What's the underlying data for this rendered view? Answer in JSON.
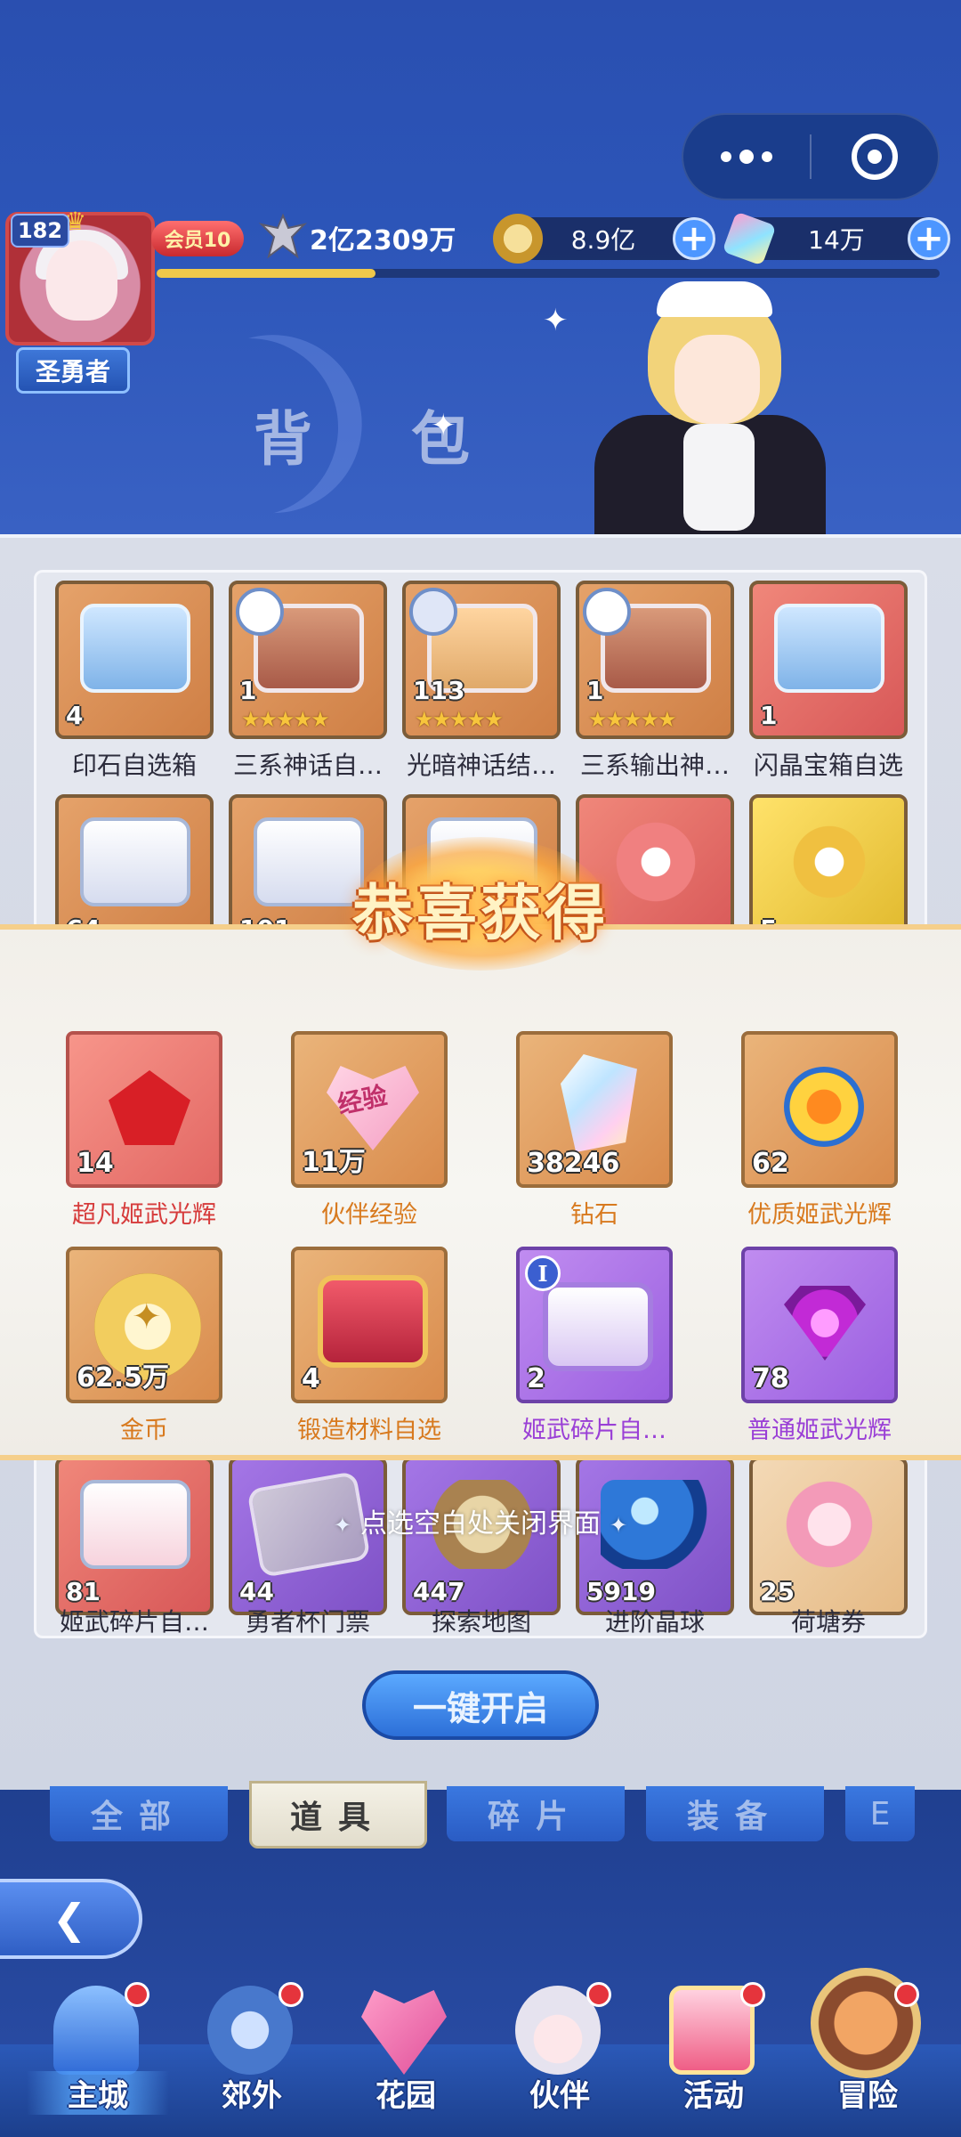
{
  "header": {
    "level": "182",
    "title_tag": "圣勇者",
    "vip": "会员10",
    "power": "2亿2309万",
    "exp_progress": 0.28,
    "gold": "8.9亿",
    "gems": "14万",
    "page_title": "背 包"
  },
  "bag_items_row1": [
    {
      "count": "4",
      "label": "印石自选箱",
      "color": "orange"
    },
    {
      "count": "1",
      "label": "三系神话自…",
      "color": "orange",
      "stars": "★★★★★"
    },
    {
      "count": "113",
      "label": "光暗神话结…",
      "color": "orange",
      "stars": "★★★★★"
    },
    {
      "count": "1",
      "label": "三系输出神…",
      "color": "orange",
      "stars": "★★★★★"
    },
    {
      "count": "1",
      "label": "闪晶宝箱自选",
      "color": "red"
    }
  ],
  "bag_items_row2": [
    {
      "count": "64",
      "color": "orange"
    },
    {
      "count": "101",
      "color": "orange"
    },
    {
      "count": "",
      "color": "orange"
    },
    {
      "count": "2",
      "color": "red"
    },
    {
      "count": "5",
      "color": "gold"
    }
  ],
  "bag_items_bottom": [
    {
      "count": "81",
      "label": "姬武碎片自…",
      "color": "red"
    },
    {
      "count": "44",
      "label": "勇者杯门票",
      "color": "purple"
    },
    {
      "count": "447",
      "label": "探索地图",
      "color": "purple"
    },
    {
      "count": "5919",
      "label": "进阶晶球",
      "color": "purple"
    },
    {
      "count": "25",
      "label": "荷塘券",
      "color": "orange"
    }
  ],
  "reward": {
    "title": "恭喜获得",
    "items": [
      {
        "count": "14",
        "label": "超凡姬武光辉",
        "rarity": "red"
      },
      {
        "count": "11万",
        "label": "伙伴经验",
        "rarity": "orange",
        "icon_text": "经验"
      },
      {
        "count": "38246",
        "label": "钻石",
        "rarity": "orange"
      },
      {
        "count": "62",
        "label": "优质姬武光辉",
        "rarity": "orange"
      },
      {
        "count": "62.5万",
        "label": "金币",
        "rarity": "orange"
      },
      {
        "count": "4",
        "label": "锻造材料自选",
        "rarity": "orange"
      },
      {
        "count": "2",
        "label": "姬武碎片自…",
        "rarity": "purple",
        "badge": "I"
      },
      {
        "count": "78",
        "label": "普通姬武光辉",
        "rarity": "purple"
      }
    ],
    "close_hint": "点选空白处关闭界面"
  },
  "actions": {
    "open_all": "一键开启"
  },
  "tabs": [
    "全部",
    "道具",
    "碎片",
    "装备",
    "E"
  ],
  "active_tab": "道具",
  "nav": [
    {
      "label": "主城",
      "active": true,
      "dot": true
    },
    {
      "label": "郊外",
      "active": false,
      "dot": true
    },
    {
      "label": "花园",
      "active": false,
      "dot": false
    },
    {
      "label": "伙伴",
      "active": false,
      "dot": true
    },
    {
      "label": "活动",
      "active": false,
      "dot": true
    },
    {
      "label": "冒险",
      "active": false,
      "dot": true
    }
  ],
  "colors": {
    "reward_red_text": "#d63b3b",
    "reward_orange_text": "#d87a1f",
    "reward_purple_text": "#9a3fd6",
    "accent_blue": "#2c6fd8"
  }
}
